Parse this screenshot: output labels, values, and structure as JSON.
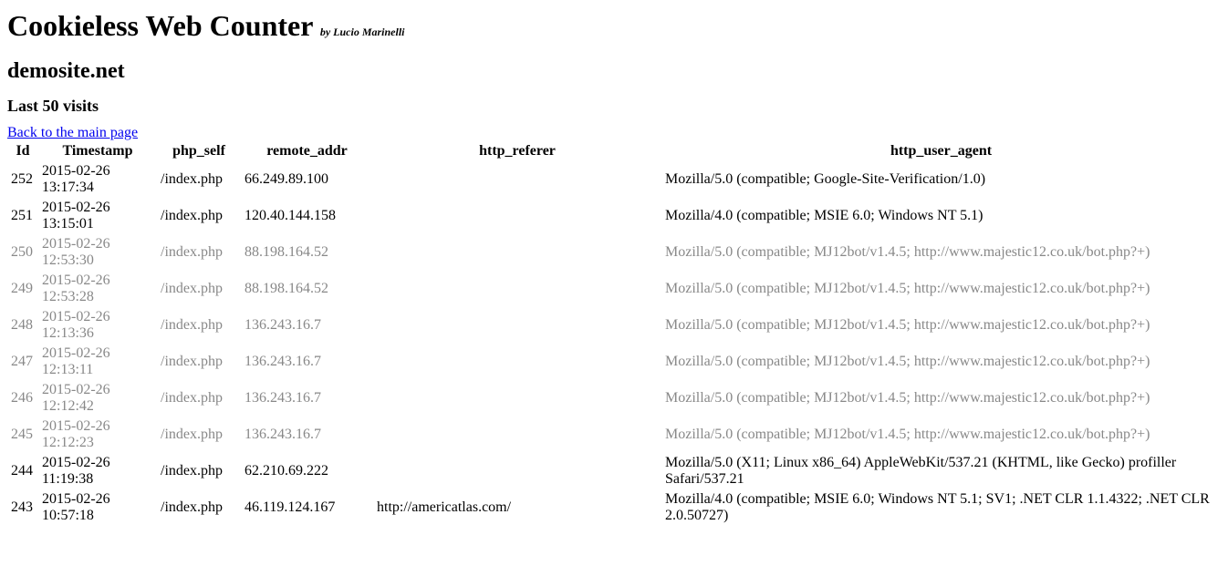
{
  "header": {
    "title": "Cookieless Web Counter",
    "byline": "by Lucio Marinelli",
    "site": "demosite.net",
    "subtitle": "Last 50 visits",
    "back_link": "Back to the main page"
  },
  "table": {
    "columns": [
      "Id",
      "Timestamp",
      "php_self",
      "remote_addr",
      "http_referer",
      "http_user_agent"
    ],
    "rows": [
      {
        "id": "252",
        "ts": "2015-02-26 13:17:34",
        "ps": "/index.php",
        "ra": "66.249.89.100",
        "rf": "",
        "ua": "Mozilla/5.0 (compatible; Google-Site-Verification/1.0)",
        "dim": false
      },
      {
        "id": "251",
        "ts": "2015-02-26 13:15:01",
        "ps": "/index.php",
        "ra": "120.40.144.158",
        "rf": "",
        "ua": "Mozilla/4.0 (compatible; MSIE 6.0; Windows NT 5.1)",
        "dim": false
      },
      {
        "id": "250",
        "ts": "2015-02-26 12:53:30",
        "ps": "/index.php",
        "ra": "88.198.164.52",
        "rf": "",
        "ua": "Mozilla/5.0 (compatible; MJ12bot/v1.4.5; http://www.majestic12.co.uk/bot.php?+)",
        "dim": true
      },
      {
        "id": "249",
        "ts": "2015-02-26 12:53:28",
        "ps": "/index.php",
        "ra": "88.198.164.52",
        "rf": "",
        "ua": "Mozilla/5.0 (compatible; MJ12bot/v1.4.5; http://www.majestic12.co.uk/bot.php?+)",
        "dim": true
      },
      {
        "id": "248",
        "ts": "2015-02-26 12:13:36",
        "ps": "/index.php",
        "ra": "136.243.16.7",
        "rf": "",
        "ua": "Mozilla/5.0 (compatible; MJ12bot/v1.4.5; http://www.majestic12.co.uk/bot.php?+)",
        "dim": true
      },
      {
        "id": "247",
        "ts": "2015-02-26 12:13:11",
        "ps": "/index.php",
        "ra": "136.243.16.7",
        "rf": "",
        "ua": "Mozilla/5.0 (compatible; MJ12bot/v1.4.5; http://www.majestic12.co.uk/bot.php?+)",
        "dim": true
      },
      {
        "id": "246",
        "ts": "2015-02-26 12:12:42",
        "ps": "/index.php",
        "ra": "136.243.16.7",
        "rf": "",
        "ua": "Mozilla/5.0 (compatible; MJ12bot/v1.4.5; http://www.majestic12.co.uk/bot.php?+)",
        "dim": true
      },
      {
        "id": "245",
        "ts": "2015-02-26 12:12:23",
        "ps": "/index.php",
        "ra": "136.243.16.7",
        "rf": "",
        "ua": "Mozilla/5.0 (compatible; MJ12bot/v1.4.5; http://www.majestic12.co.uk/bot.php?+)",
        "dim": true
      },
      {
        "id": "244",
        "ts": "2015-02-26 11:19:38",
        "ps": "/index.php",
        "ra": "62.210.69.222",
        "rf": "",
        "ua": "Mozilla/5.0 (X11; Linux x86_64) AppleWebKit/537.21 (KHTML, like Gecko) profiller Safari/537.21",
        "dim": false
      },
      {
        "id": "243",
        "ts": "2015-02-26 10:57:18",
        "ps": "/index.php",
        "ra": "46.119.124.167",
        "rf": "http://americatlas.com/",
        "ua": "Mozilla/4.0 (compatible; MSIE 6.0; Windows NT 5.1; SV1; .NET CLR 1.1.4322; .NET CLR 2.0.50727)",
        "dim": false
      }
    ]
  }
}
